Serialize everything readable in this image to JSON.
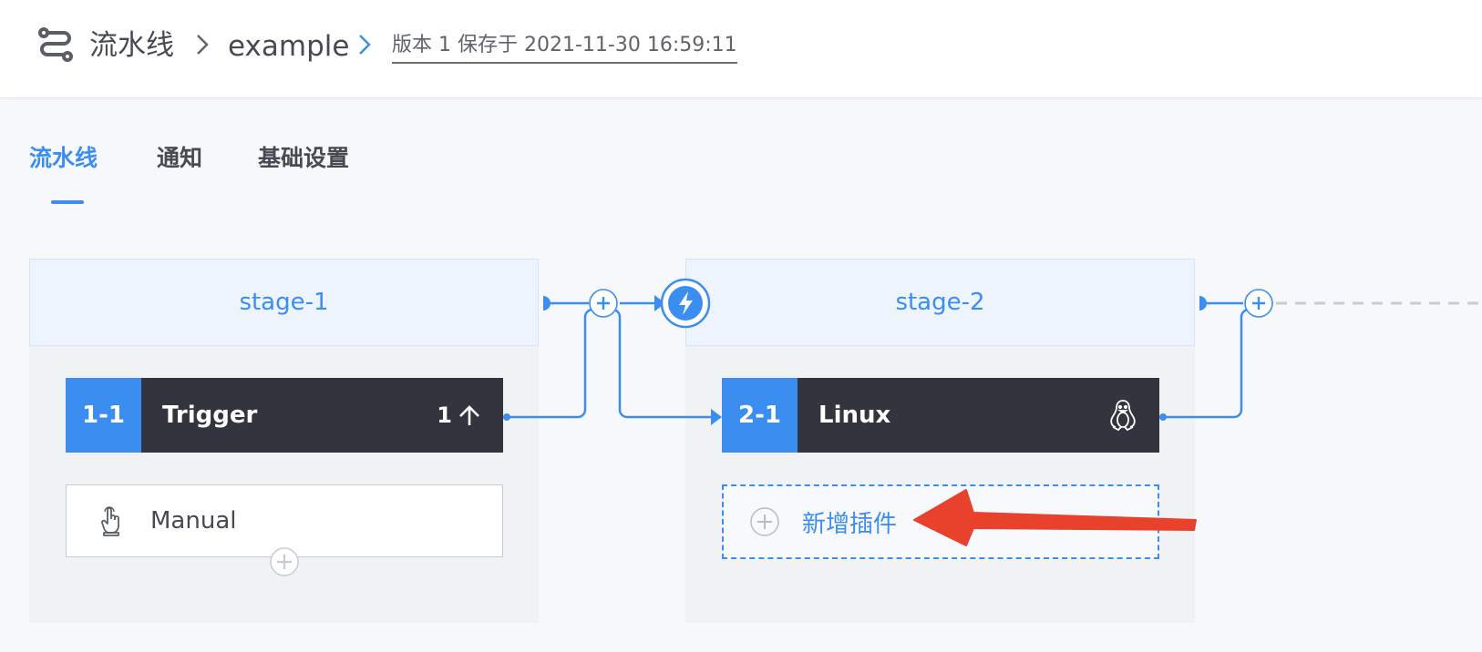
{
  "breadcrumb": {
    "root": "流水线",
    "pipeline_name": "example",
    "version_text": "版本 1 保存于 2021-11-30 16:59:11"
  },
  "tabs": [
    {
      "label": "流水线",
      "active": true
    },
    {
      "label": "通知",
      "active": false
    },
    {
      "label": "基础设置",
      "active": false
    }
  ],
  "stages": [
    {
      "name": "stage-1",
      "job": {
        "id": "1-1",
        "name": "Trigger",
        "count": "1",
        "icon": "upload-arrow-icon"
      },
      "tasks": [
        {
          "label": "Manual",
          "icon": "hand-pointer-icon"
        }
      ]
    },
    {
      "name": "stage-2",
      "job": {
        "id": "2-1",
        "name": "Linux",
        "icon": "linux-tux-icon"
      },
      "add_plugin_label": "新增插件"
    }
  ],
  "colors": {
    "accent": "#3c8df0",
    "job_bg": "#33343d",
    "annotation_arrow": "#e8412c"
  }
}
